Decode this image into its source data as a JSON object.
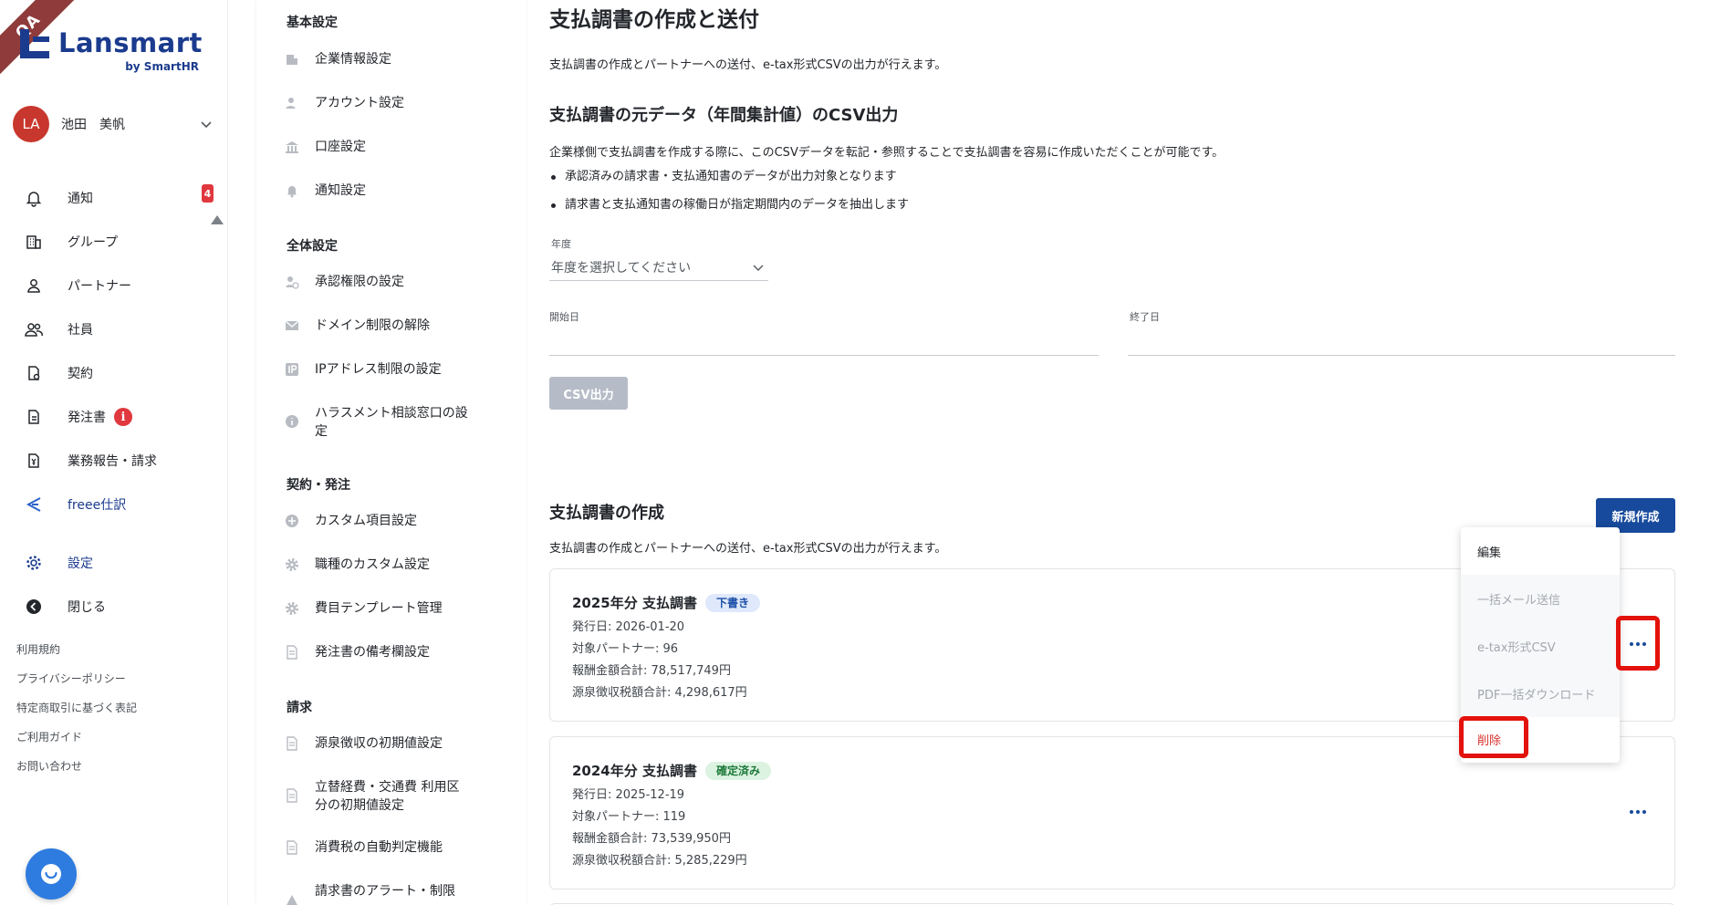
{
  "ribbon": "QA",
  "logo": {
    "word": "Lansmart",
    "byline": "by SmartHR"
  },
  "user": {
    "initials": "LA",
    "name": "池田　美帆"
  },
  "nav": {
    "items": [
      {
        "label": "通知",
        "badge": "4"
      },
      {
        "label": "グループ"
      },
      {
        "label": "パートナー"
      },
      {
        "label": "社員"
      },
      {
        "label": "契約"
      },
      {
        "label": "発注書",
        "alert": "i"
      },
      {
        "label": "業務報告・請求"
      },
      {
        "label": "freee仕訳"
      }
    ],
    "settings_label": "設定",
    "close_label": "閉じる"
  },
  "footer_links": [
    "利用規約",
    "プライバシーポリシー",
    "特定商取引に基づく表記",
    "ご利用ガイド",
    "お問い合わせ"
  ],
  "settings_panel": {
    "sections": [
      {
        "heading": "基本設定",
        "items": [
          "企業情報設定",
          "アカウント設定",
          "口座設定",
          "通知設定"
        ]
      },
      {
        "heading": "全体設定",
        "items": [
          "承認権限の設定",
          "ドメイン制限の解除",
          "IPアドレス制限の設定",
          "ハラスメント相談窓口の設定"
        ]
      },
      {
        "heading": "契約・発注",
        "items": [
          "カスタム項目設定",
          "職種のカスタム設定",
          "費目テンプレート管理",
          "発注書の備考欄設定"
        ]
      },
      {
        "heading": "請求",
        "items": [
          "源泉徴収の初期値設定",
          "立替経費・交通費 利用区分の初期値設定",
          "消費税の自動判定機能",
          "請求書のアラート・制限"
        ]
      }
    ]
  },
  "main": {
    "title": "支払調書の作成と送付",
    "intro": "支払調書の作成とパートナーへの送付、e-tax形式CSVの出力が行えます。",
    "csv_section": {
      "heading": "支払調書の元データ（年間集計値）のCSV出力",
      "description": "企業様側で支払調書を作成する際に、このCSVデータを転記・参照することで支払調書を容易に作成いただくことが可能です。",
      "bullets": [
        "承認済みの請求書・支払通知書のデータが出力対象となります",
        "請求書と支払通知書の稼働日が指定期間内のデータを抽出します"
      ],
      "year_label": "年度",
      "year_placeholder": "年度を選択してください",
      "start_label": "開始日",
      "end_label": "終了日",
      "csv_button": "CSV出力"
    },
    "create_section": {
      "heading": "支払調書の作成",
      "description": "支払調書の作成とパートナーへの送付、e-tax形式CSVの出力が行えます。",
      "new_button": "新規作成"
    },
    "cards": [
      {
        "title": "2025年分 支払調書",
        "status": "下書き",
        "issue_date": "発行日: 2026-01-20",
        "partners": "対象パートナー: 96",
        "total_pay": "報酬金額合計: 78,517,749円",
        "total_tax": "源泉徴収税額合計: 4,298,617円"
      },
      {
        "title": "2024年分 支払調書",
        "status": "確定済み",
        "issue_date": "発行日: 2025-12-19",
        "partners": "対象パートナー: 119",
        "total_pay": "報酬金額合計: 73,539,950円",
        "total_tax": "源泉徴収税額合計: 5,285,229円"
      }
    ],
    "menu": {
      "edit": "編集",
      "bulk_mail": "一括メール送信",
      "etax_csv": "e-tax形式CSV",
      "pdf_download": "PDF一括ダウンロード",
      "delete": "削除"
    }
  },
  "colors": {
    "brand": "#1b3b8e",
    "primary": "#174a9c",
    "danger": "#e0383e",
    "highlight": "#e3120b"
  }
}
